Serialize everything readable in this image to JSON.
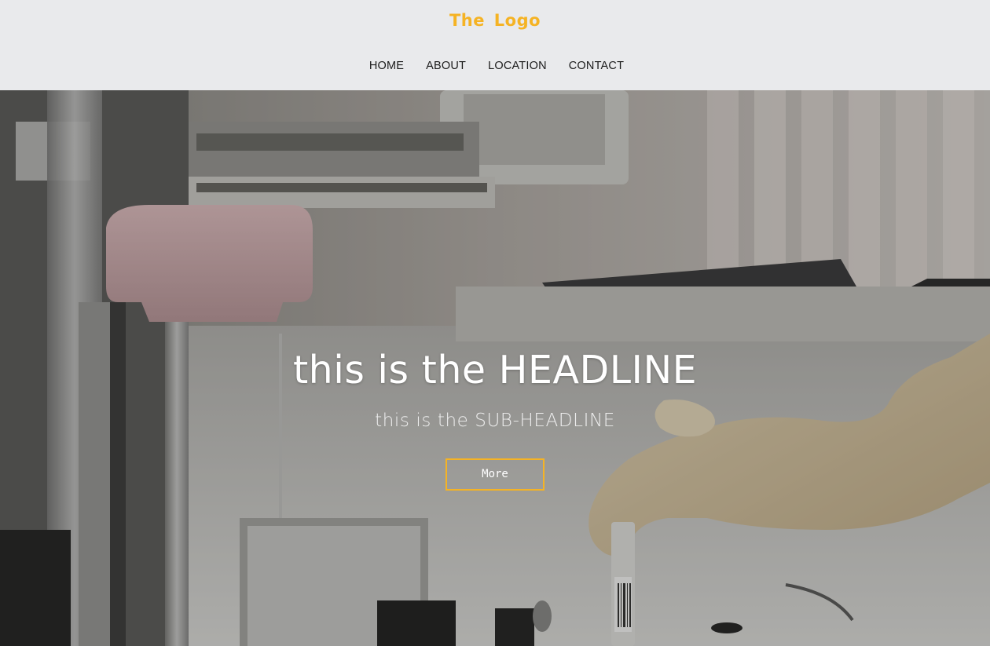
{
  "header": {
    "logo_text": "The  Logo",
    "nav": [
      {
        "label": "HOME"
      },
      {
        "label": "ABOUT"
      },
      {
        "label": "LOCATION"
      },
      {
        "label": "CONTACT"
      }
    ]
  },
  "hero": {
    "headline": "this is the HEADLINE",
    "subheadline": "this is the SUB-HEADLINE",
    "button_label": "More",
    "background_image": "laboratory-photo"
  },
  "colors": {
    "accent": "#f5b324",
    "header_bg": "#e9eaec",
    "nav_text": "#1b1b1b",
    "hero_text": "#ffffff"
  }
}
